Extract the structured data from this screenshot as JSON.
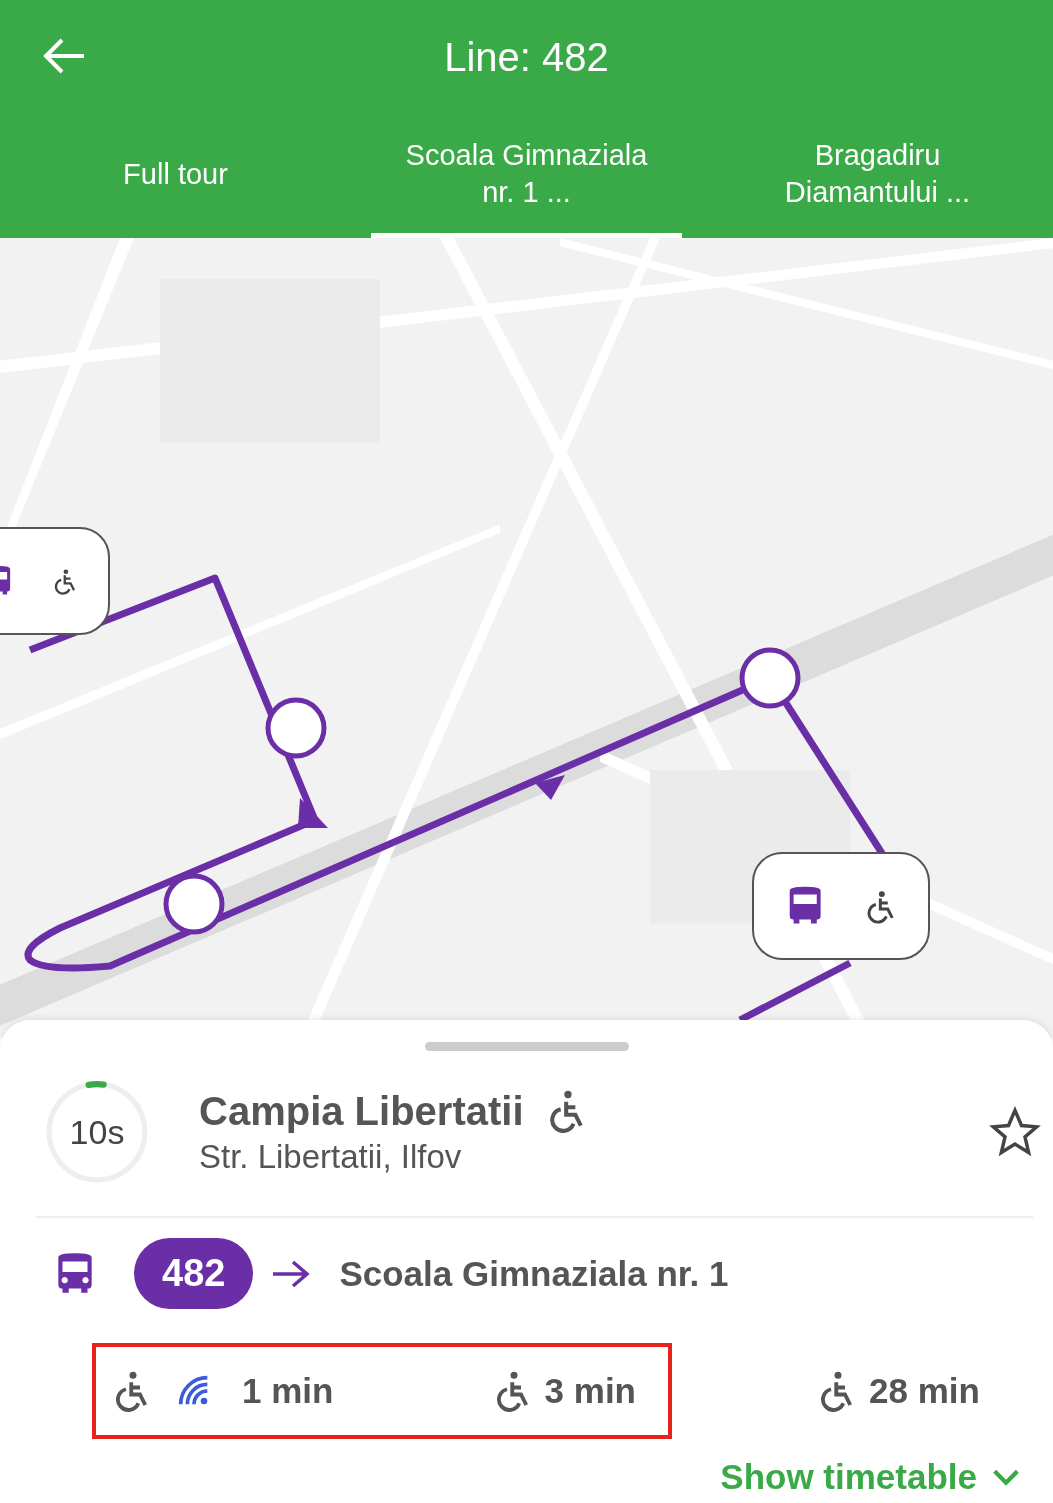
{
  "header": {
    "title": "Line: 482"
  },
  "tabs": [
    {
      "label": "Full tour",
      "selected": false
    },
    {
      "label": "Scoala Gimnaziala nr. 1 ...",
      "selected": true
    },
    {
      "label": "Bragadiru Diamantului ...",
      "selected": false
    }
  ],
  "stop": {
    "timer": {
      "label": "10s",
      "level": 0.05
    },
    "name": "Campia Libertatii",
    "accessible": true,
    "address": "Str. Libertatii, Ilfov",
    "favorite": false
  },
  "line": {
    "number": "482",
    "destination": "Scoala Gimnaziala nr. 1"
  },
  "arrivals": [
    {
      "time": "1 min",
      "accessible": true,
      "live": true,
      "highlighted": true
    },
    {
      "time": "3 min",
      "accessible": true,
      "live": false,
      "highlighted": true
    },
    {
      "time": "28 min",
      "accessible": true,
      "live": false,
      "highlighted": false
    }
  ],
  "timetable_link": {
    "label": "Show timetable",
    "expanded": false
  }
}
